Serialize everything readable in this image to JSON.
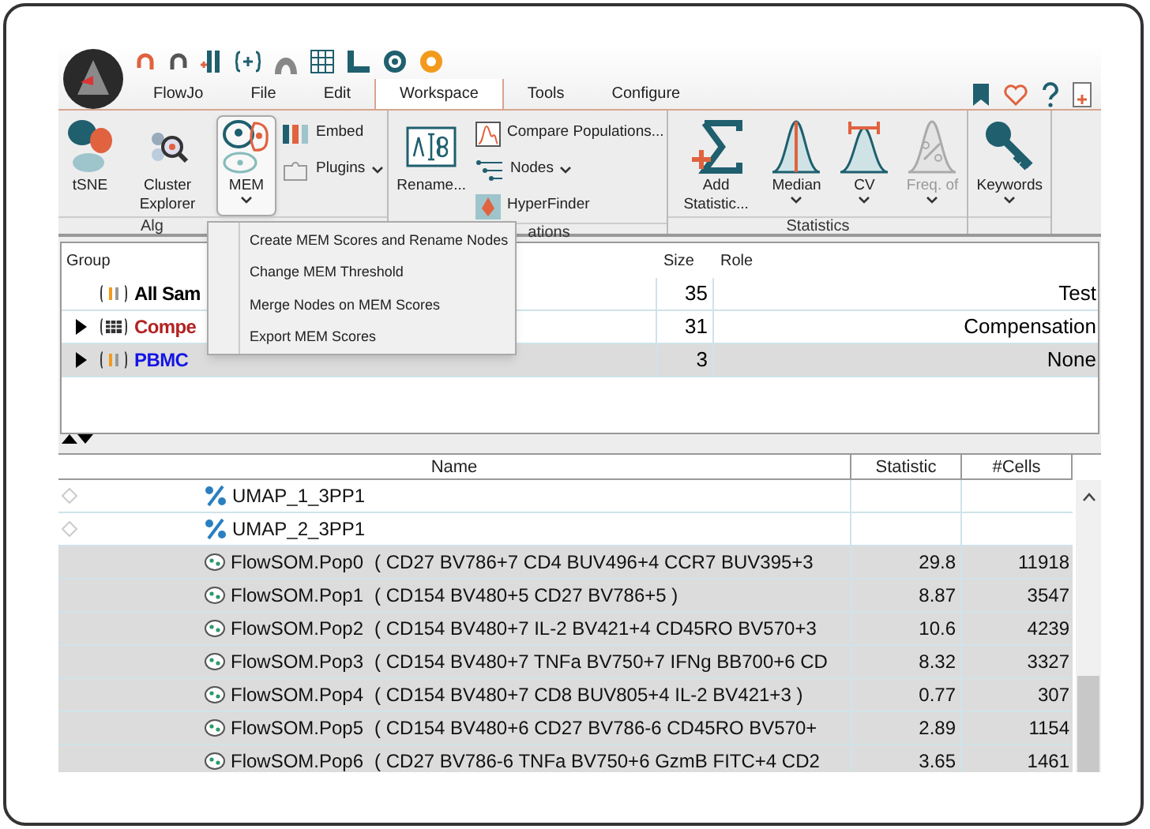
{
  "menu_tabs": [
    {
      "label": "FlowJo",
      "selected": false
    },
    {
      "label": "File",
      "selected": false
    },
    {
      "label": "Edit",
      "selected": false
    },
    {
      "label": "Workspace",
      "selected": true
    },
    {
      "label": "Tools",
      "selected": false
    },
    {
      "label": "Configure",
      "selected": false
    }
  ],
  "ribbon_groups": [
    {
      "label": "Alg",
      "items": [
        {
          "kind": "large",
          "label": "tSNE",
          "dropdown": false,
          "pressed": false,
          "disabled": false
        },
        {
          "kind": "large",
          "label": "Cluster Explorer",
          "dropdown": false,
          "pressed": false,
          "disabled": false
        },
        {
          "kind": "large",
          "label": "MEM",
          "dropdown": true,
          "pressed": true,
          "disabled": false
        },
        {
          "kind": "small",
          "label": "Embed",
          "dropdown": false
        },
        {
          "kind": "small",
          "label": "Plugins",
          "dropdown": true
        }
      ]
    },
    {
      "label": "ations",
      "items": [
        {
          "kind": "large",
          "label": "Rename...",
          "dropdown": false,
          "pressed": false,
          "disabled": false
        },
        {
          "kind": "small",
          "label": "Compare Populations...",
          "dropdown": false
        },
        {
          "kind": "small",
          "label": "Nodes",
          "dropdown": true
        },
        {
          "kind": "small",
          "label": "HyperFinder",
          "dropdown": false
        }
      ]
    },
    {
      "label": "Statistics",
      "items": [
        {
          "kind": "large",
          "label": "Add Statistic...",
          "dropdown": false,
          "pressed": false,
          "disabled": false
        },
        {
          "kind": "large",
          "label": "Median",
          "dropdown": true,
          "pressed": false,
          "disabled": false
        },
        {
          "kind": "large",
          "label": "CV",
          "dropdown": true,
          "pressed": false,
          "disabled": false
        },
        {
          "kind": "large",
          "label": "Freq. of",
          "dropdown": true,
          "pressed": false,
          "disabled": true
        }
      ]
    },
    {
      "items": [
        {
          "kind": "large",
          "label": "Keywords",
          "dropdown": true,
          "pressed": false,
          "disabled": false
        }
      ]
    }
  ],
  "mem_menu": {
    "items": [
      "Create MEM Scores and Rename Nodes",
      "Change MEM Threshold",
      "Merge Nodes on MEM Scores",
      "Export MEM Scores"
    ]
  },
  "group_table": {
    "columns": [
      "Group",
      "Size",
      "Role"
    ],
    "rows": [
      {
        "kind": "group",
        "name": "All Sam",
        "size": "35",
        "role": "Test",
        "color": "#000000",
        "expandable": false,
        "selected": false
      },
      {
        "kind": "compensation",
        "name": "Compe",
        "size": "31",
        "role": "Compensation",
        "color": "#b22222",
        "expandable": true,
        "selected": false
      },
      {
        "kind": "group",
        "name": "PBMC",
        "size": "3",
        "role": "None",
        "color": "#1414e6",
        "expandable": true,
        "selected": true
      }
    ]
  },
  "node_table": {
    "columns": [
      "Name",
      "Statistic",
      "#Cells"
    ],
    "rows": [
      {
        "kind": "parameter",
        "name": "UMAP_1_3PP1",
        "selected": false
      },
      {
        "kind": "parameter",
        "name": "UMAP_2_3PP1",
        "selected": false
      },
      {
        "kind": "population",
        "name": "FlowSOM.Pop0",
        "description": "( CD27 BV786+7 CD4 BUV496+4 CCR7 BUV395+3",
        "statistic": "29.8",
        "cells": "11918",
        "selected": true
      },
      {
        "kind": "population",
        "name": "FlowSOM.Pop1",
        "description": "( CD154 BV480+5 CD27 BV786+5 )",
        "statistic": "8.87",
        "cells": "3547",
        "selected": true
      },
      {
        "kind": "population",
        "name": "FlowSOM.Pop2",
        "description": "( CD154 BV480+7 IL-2 BV421+4 CD45RO BV570+3",
        "statistic": "10.6",
        "cells": "4239",
        "selected": true
      },
      {
        "kind": "population",
        "name": "FlowSOM.Pop3",
        "description": "( CD154 BV480+7 TNFa BV750+7 IFNg BB700+6 CD",
        "statistic": "8.32",
        "cells": "3327",
        "selected": true
      },
      {
        "kind": "population",
        "name": "FlowSOM.Pop4",
        "description": "( CD154 BV480+7 CD8 BUV805+4 IL-2 BV421+3 )",
        "statistic": "0.77",
        "cells": "307",
        "selected": true
      },
      {
        "kind": "population",
        "name": "FlowSOM.Pop5",
        "description": "( CD154 BV480+6 CD27 BV786-6 CD45RO BV570+",
        "statistic": "2.89",
        "cells": "1154",
        "selected": true
      },
      {
        "kind": "population",
        "name": "FlowSOM.Pop6",
        "description": "( CD27 BV786-6 TNFa BV750+6 GzmB FITC+4 CD2",
        "statistic": "3.65",
        "cells": "1461",
        "selected": true
      }
    ]
  }
}
